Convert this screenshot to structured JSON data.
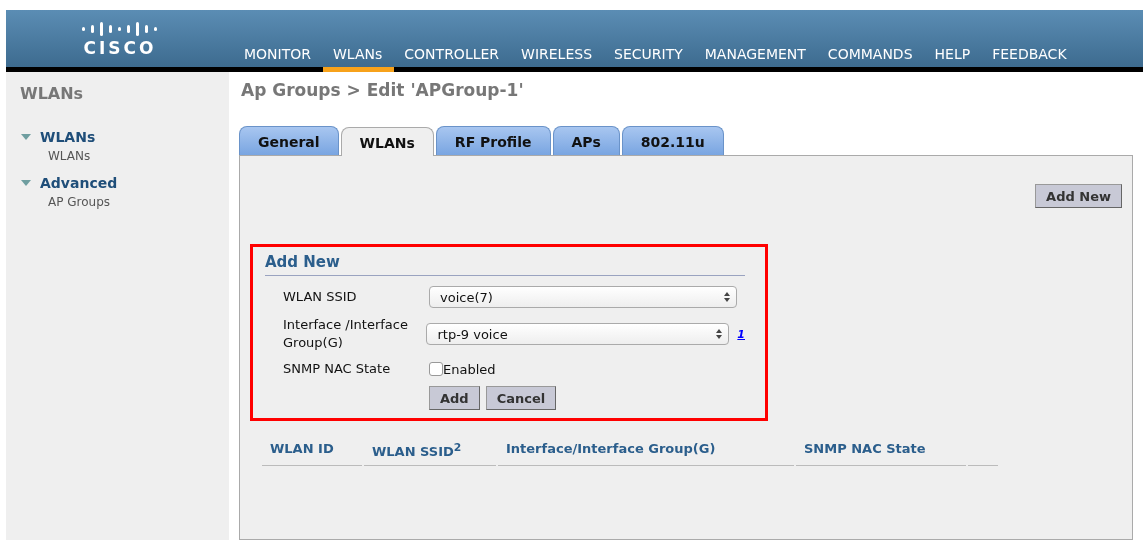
{
  "header": {
    "logo": "CISCO",
    "menu": [
      {
        "label": "MONITOR",
        "selected": false
      },
      {
        "label": "WLANs",
        "selected": true
      },
      {
        "label": "CONTROLLER",
        "selected": false
      },
      {
        "label": "WIRELESS",
        "selected": false
      },
      {
        "label": "SECURITY",
        "selected": false
      },
      {
        "label": "MANAGEMENT",
        "selected": false
      },
      {
        "label": "COMMANDS",
        "selected": false
      },
      {
        "label": "HELP",
        "selected": false
      },
      {
        "label": "FEEDBACK",
        "selected": false
      }
    ]
  },
  "sidebar": {
    "title": "WLANs",
    "sections": [
      {
        "label": "WLANs",
        "expanded": true,
        "children": [
          {
            "label": "WLANs"
          }
        ]
      },
      {
        "label": "Advanced",
        "expanded": true,
        "children": [
          {
            "label": "AP Groups"
          }
        ]
      }
    ]
  },
  "page_title": "Ap Groups > Edit  'APGroup-1'",
  "tabs": [
    {
      "label": "General",
      "selected": false
    },
    {
      "label": "WLANs",
      "selected": true
    },
    {
      "label": "RF Profile",
      "selected": false
    },
    {
      "label": "APs",
      "selected": false
    },
    {
      "label": "802.11u",
      "selected": false
    }
  ],
  "add_new_button": "Add New",
  "add_form": {
    "title": "Add New",
    "fields": [
      {
        "kind": "select",
        "label": "WLAN SSID",
        "value": "voice(7)"
      },
      {
        "kind": "select",
        "label": "Interface /Interface Group(G)",
        "value": "rtp-9 voice",
        "note": "1"
      },
      {
        "kind": "checkbox",
        "label": "SNMP NAC State",
        "option": "Enabled",
        "checked": false
      }
    ],
    "buttons": [
      "Add",
      "Cancel"
    ]
  },
  "table": {
    "columns": [
      "WLAN ID",
      "WLAN SSID$^{2}$",
      "Interface/Interface Group(G)",
      "SNMP NAC State"
    ]
  }
}
